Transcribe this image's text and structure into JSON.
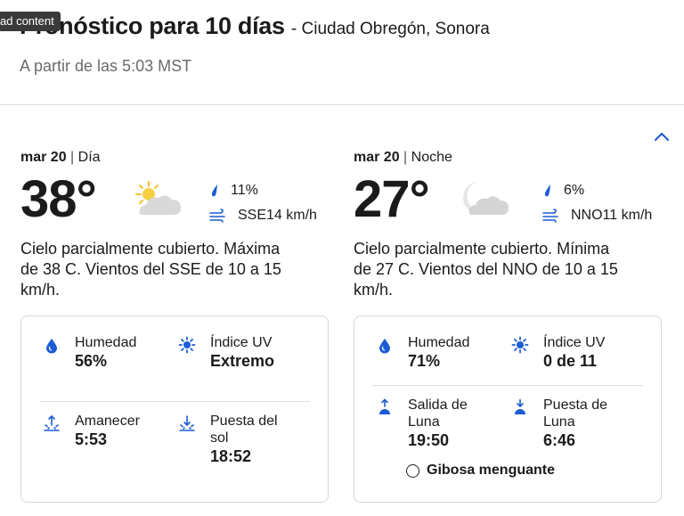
{
  "ad_tag": "ad content",
  "header": {
    "title": "Pronóstico para 10 días",
    "location": "- Ciudad Obregón, Sonora",
    "updated": "A partir de las 5:03 MST"
  },
  "colors": {
    "accent": "#1a5bd6",
    "text": "#1b1b1b",
    "muted": "#6b6b6b",
    "divider": "#dcdcdc"
  },
  "day": {
    "date": "mar 20",
    "period": "Día",
    "temp": "38°",
    "icon": "partly-cloudy-sun-icon",
    "precip": "11%",
    "wind": "SSE14 km/h",
    "description": "Cielo parcialmente cubierto. Máxima de 38 C. Vientos del SSE de 10 a 15 km/h.",
    "details": {
      "humidity_label": "Humedad",
      "humidity": "56%",
      "uv_label": "Índice UV",
      "uv": "Extremo",
      "sunrise_label": "Amanecer",
      "sunrise": "5:53",
      "sunset_label": "Puesta del sol",
      "sunset": "18:52"
    }
  },
  "night": {
    "date": "mar 20",
    "period": "Noche",
    "temp": "27°",
    "icon": "partly-cloudy-moon-icon",
    "precip": "6%",
    "wind": "NNO11 km/h",
    "description": "Cielo parcialmente cubierto. Mínima de 27 C. Vientos del NNO de 10 a 15 km/h.",
    "details": {
      "humidity_label": "Humedad",
      "humidity": "71%",
      "uv_label": "Índice UV",
      "uv": "0 de 11",
      "moonrise_label": "Salida de Luna",
      "moonrise": "19:50",
      "moonset_label": "Puesta de Luna",
      "moonset": "6:46",
      "moon_phase": "Gibosa menguante"
    }
  }
}
